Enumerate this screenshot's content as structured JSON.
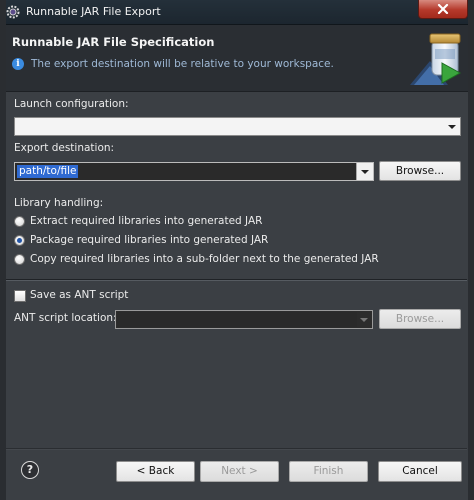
{
  "window": {
    "title": "Runnable JAR File Export"
  },
  "header": {
    "title": "Runnable JAR File Specification",
    "message": "The export destination will be relative to your workspace."
  },
  "launch_configuration": {
    "label": "Launch configuration:",
    "value": ""
  },
  "export_destination": {
    "label": "Export destination:",
    "value": "path/to/file",
    "browse_label": "Browse..."
  },
  "library_handling": {
    "label": "Library handling:",
    "options": [
      {
        "label": "Extract required libraries into generated JAR",
        "selected": false
      },
      {
        "label": "Package required libraries into generated JAR",
        "selected": true
      },
      {
        "label": "Copy required libraries into a sub-folder next to the generated JAR",
        "selected": false
      }
    ]
  },
  "ant": {
    "save_label": "Save as ANT script",
    "save_checked": false,
    "location_label": "ANT script location:",
    "location_value": "",
    "browse_label": "Browse..."
  },
  "footer": {
    "help_glyph": "?",
    "back_label": "< Back",
    "next_label": "Next >",
    "finish_label": "Finish",
    "cancel_label": "Cancel"
  },
  "icons": {
    "app": "eclipse-gear-icon",
    "close": "close-icon",
    "info": "info-icon",
    "banner": "jar-export-wizard-icon",
    "help": "help-icon"
  },
  "colors": {
    "background": "#3b3f44",
    "header_background": "#2a2e33",
    "selection": "#2f6ad1",
    "close_button": "#b5392b",
    "info_text": "#9fb9d6"
  }
}
